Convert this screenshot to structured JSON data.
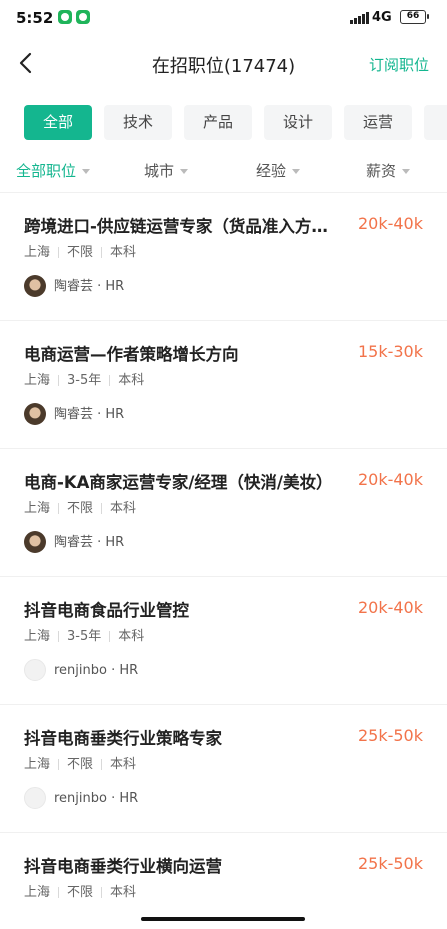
{
  "status_bar": {
    "time": "5:52",
    "network": "4G",
    "battery": "66"
  },
  "header": {
    "title": "在招职位(17474)",
    "subscribe_label": "订阅职位"
  },
  "tabs": [
    {
      "label": "全部",
      "active": true
    },
    {
      "label": "技术",
      "active": false
    },
    {
      "label": "产品",
      "active": false
    },
    {
      "label": "设计",
      "active": false
    },
    {
      "label": "运营",
      "active": false
    }
  ],
  "filters": [
    {
      "label": "全部职位",
      "active": true
    },
    {
      "label": "城市",
      "active": false
    },
    {
      "label": "经验",
      "active": false
    },
    {
      "label": "薪资",
      "active": false
    }
  ],
  "jobs": [
    {
      "title": "跨境进口-供应链运营专家（货品准入方向）",
      "salary": "20k-40k",
      "city": "上海",
      "experience": "不限",
      "education": "本科",
      "hr": "陶睿芸 · HR",
      "avatar": "photo"
    },
    {
      "title": "电商运营—作者策略增长方向",
      "salary": "15k-30k",
      "city": "上海",
      "experience": "3-5年",
      "education": "本科",
      "hr": "陶睿芸 · HR",
      "avatar": "photo"
    },
    {
      "title": "电商-KA商家运营专家/经理（快消/美妆）",
      "salary": "20k-40k",
      "city": "上海",
      "experience": "不限",
      "education": "本科",
      "hr": "陶睿芸 · HR",
      "avatar": "photo"
    },
    {
      "title": "抖音电商食品行业管控",
      "salary": "20k-40k",
      "city": "上海",
      "experience": "3-5年",
      "education": "本科",
      "hr": "renjinbo · HR",
      "avatar": "logo"
    },
    {
      "title": "抖音电商垂类行业策略专家",
      "salary": "25k-50k",
      "city": "上海",
      "experience": "不限",
      "education": "本科",
      "hr": "renjinbo · HR",
      "avatar": "logo"
    },
    {
      "title": "抖音电商垂类行业横向运营",
      "salary": "25k-50k",
      "city": "上海",
      "experience": "不限",
      "education": "本科",
      "hr": "",
      "avatar": ""
    }
  ],
  "colors": {
    "accent": "#14b68f",
    "salary": "#f2734a"
  }
}
